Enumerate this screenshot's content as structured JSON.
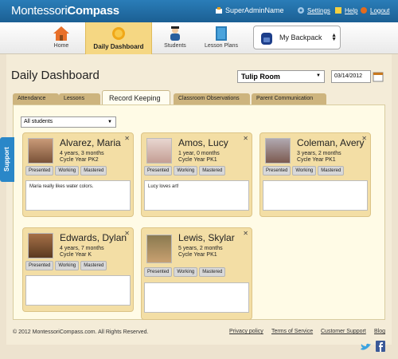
{
  "header": {
    "logo_light": "Montessori",
    "logo_bold": "Compass",
    "user": "SuperAdminName",
    "settings": "Settings",
    "help": "Help",
    "logout": "Logout"
  },
  "nav": {
    "home": "Home",
    "daily_dashboard": "Daily Dashboard",
    "students": "Students",
    "lesson_plans": "Lesson Plans",
    "backpack": "My Backpack"
  },
  "page": {
    "title": "Daily Dashboard",
    "room": "Tulip Room",
    "date": "03/14/2012",
    "filter": "All students"
  },
  "tabs": [
    "Attendance",
    "Lessons",
    "Record Keeping",
    "Classroom Observations",
    "Parent Communication"
  ],
  "support": "Support",
  "students": [
    {
      "name": "Alvarez, Maria",
      "age": "4 years, 3 months",
      "cycle": "Cycle Year PK2",
      "note": "Maria really likes water colors."
    },
    {
      "name": "Amos, Lucy",
      "age": "1 year, 0 months",
      "cycle": "Cycle Year PK1",
      "note": "Lucy loves art!"
    },
    {
      "name": "Coleman, Avery",
      "age": "3 years, 2 months",
      "cycle": "Cycle Year PK1",
      "note": ""
    },
    {
      "name": "Edwards, Dylan",
      "age": "4 years, 7 months",
      "cycle": "Cycle Year K",
      "note": ""
    },
    {
      "name": "Lewis, Skylar",
      "age": "5 years, 2 months",
      "cycle": "Cycle Year PK1",
      "note": ""
    }
  ],
  "status_buttons": [
    "Presented",
    "Working",
    "Mastered"
  ],
  "footer": {
    "copyright": "© 2012 MontessoriCompass.com. All Rights Reserved.",
    "privacy": "Privacy policy",
    "terms": "Terms of Service",
    "support": "Customer Support",
    "blog": "Blog"
  },
  "colors": {
    "topbar": "#1f6ca6",
    "accent": "#f5d783",
    "card": "#f3dea5"
  }
}
